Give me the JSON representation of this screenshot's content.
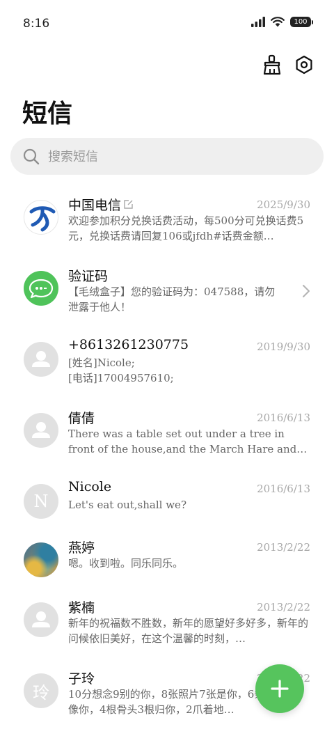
{
  "status_bar": {
    "time": "8:16",
    "battery": "100"
  },
  "header": {
    "title": "短信"
  },
  "search": {
    "placeholder": "搜索短信"
  },
  "conversations": [
    {
      "name": "中国电信",
      "date": "2025/9/30",
      "preview": "欢迎参加积分兑换话费活动，每500分可兑换话费5元，兑换话费请回复106或jfdh#话费金额…"
    },
    {
      "name": "验证码",
      "date": "",
      "preview": "【毛绒盒子】您的验证码为：047588，请勿泄露于他人！"
    },
    {
      "name": "+8613261230775",
      "date": "2019/9/30",
      "preview": "[姓名]Nicole;\n[电话]17004957610;"
    },
    {
      "name": "倩倩",
      "date": "2016/6/13",
      "preview": "There was a table set out under a tree in front of the house,and the March Hare and the Hatte…"
    },
    {
      "name": "Nicole",
      "avatar_letter": "N",
      "date": "2016/6/13",
      "preview": "Let's eat out,shall we?"
    },
    {
      "name": "燕婷",
      "date": "2013/2/22",
      "preview": "嗯。收到啦。同乐同乐。"
    },
    {
      "name": "紫楠",
      "date": "2013/2/22",
      "preview": "新年的祝福数不胜数，新年的愿望好多好多，新年的问候依旧美好，在这个温馨的时刻，…"
    },
    {
      "name": "子玲",
      "avatar_letter": "玲",
      "date": "2013/2/22",
      "preview": "10分想念9别的你，8张照片7张是你，6条小狗5只像你，4根骨头3根归你，2爪着地…"
    }
  ],
  "colors": {
    "accent": "#56c45d",
    "telecom_blue": "#1f5ab4",
    "avatar_gray": "#e1e1e1"
  },
  "icons": {
    "header": [
      "broom-icon",
      "settings-icon"
    ],
    "search": "search-icon",
    "fab": "plus-icon"
  }
}
